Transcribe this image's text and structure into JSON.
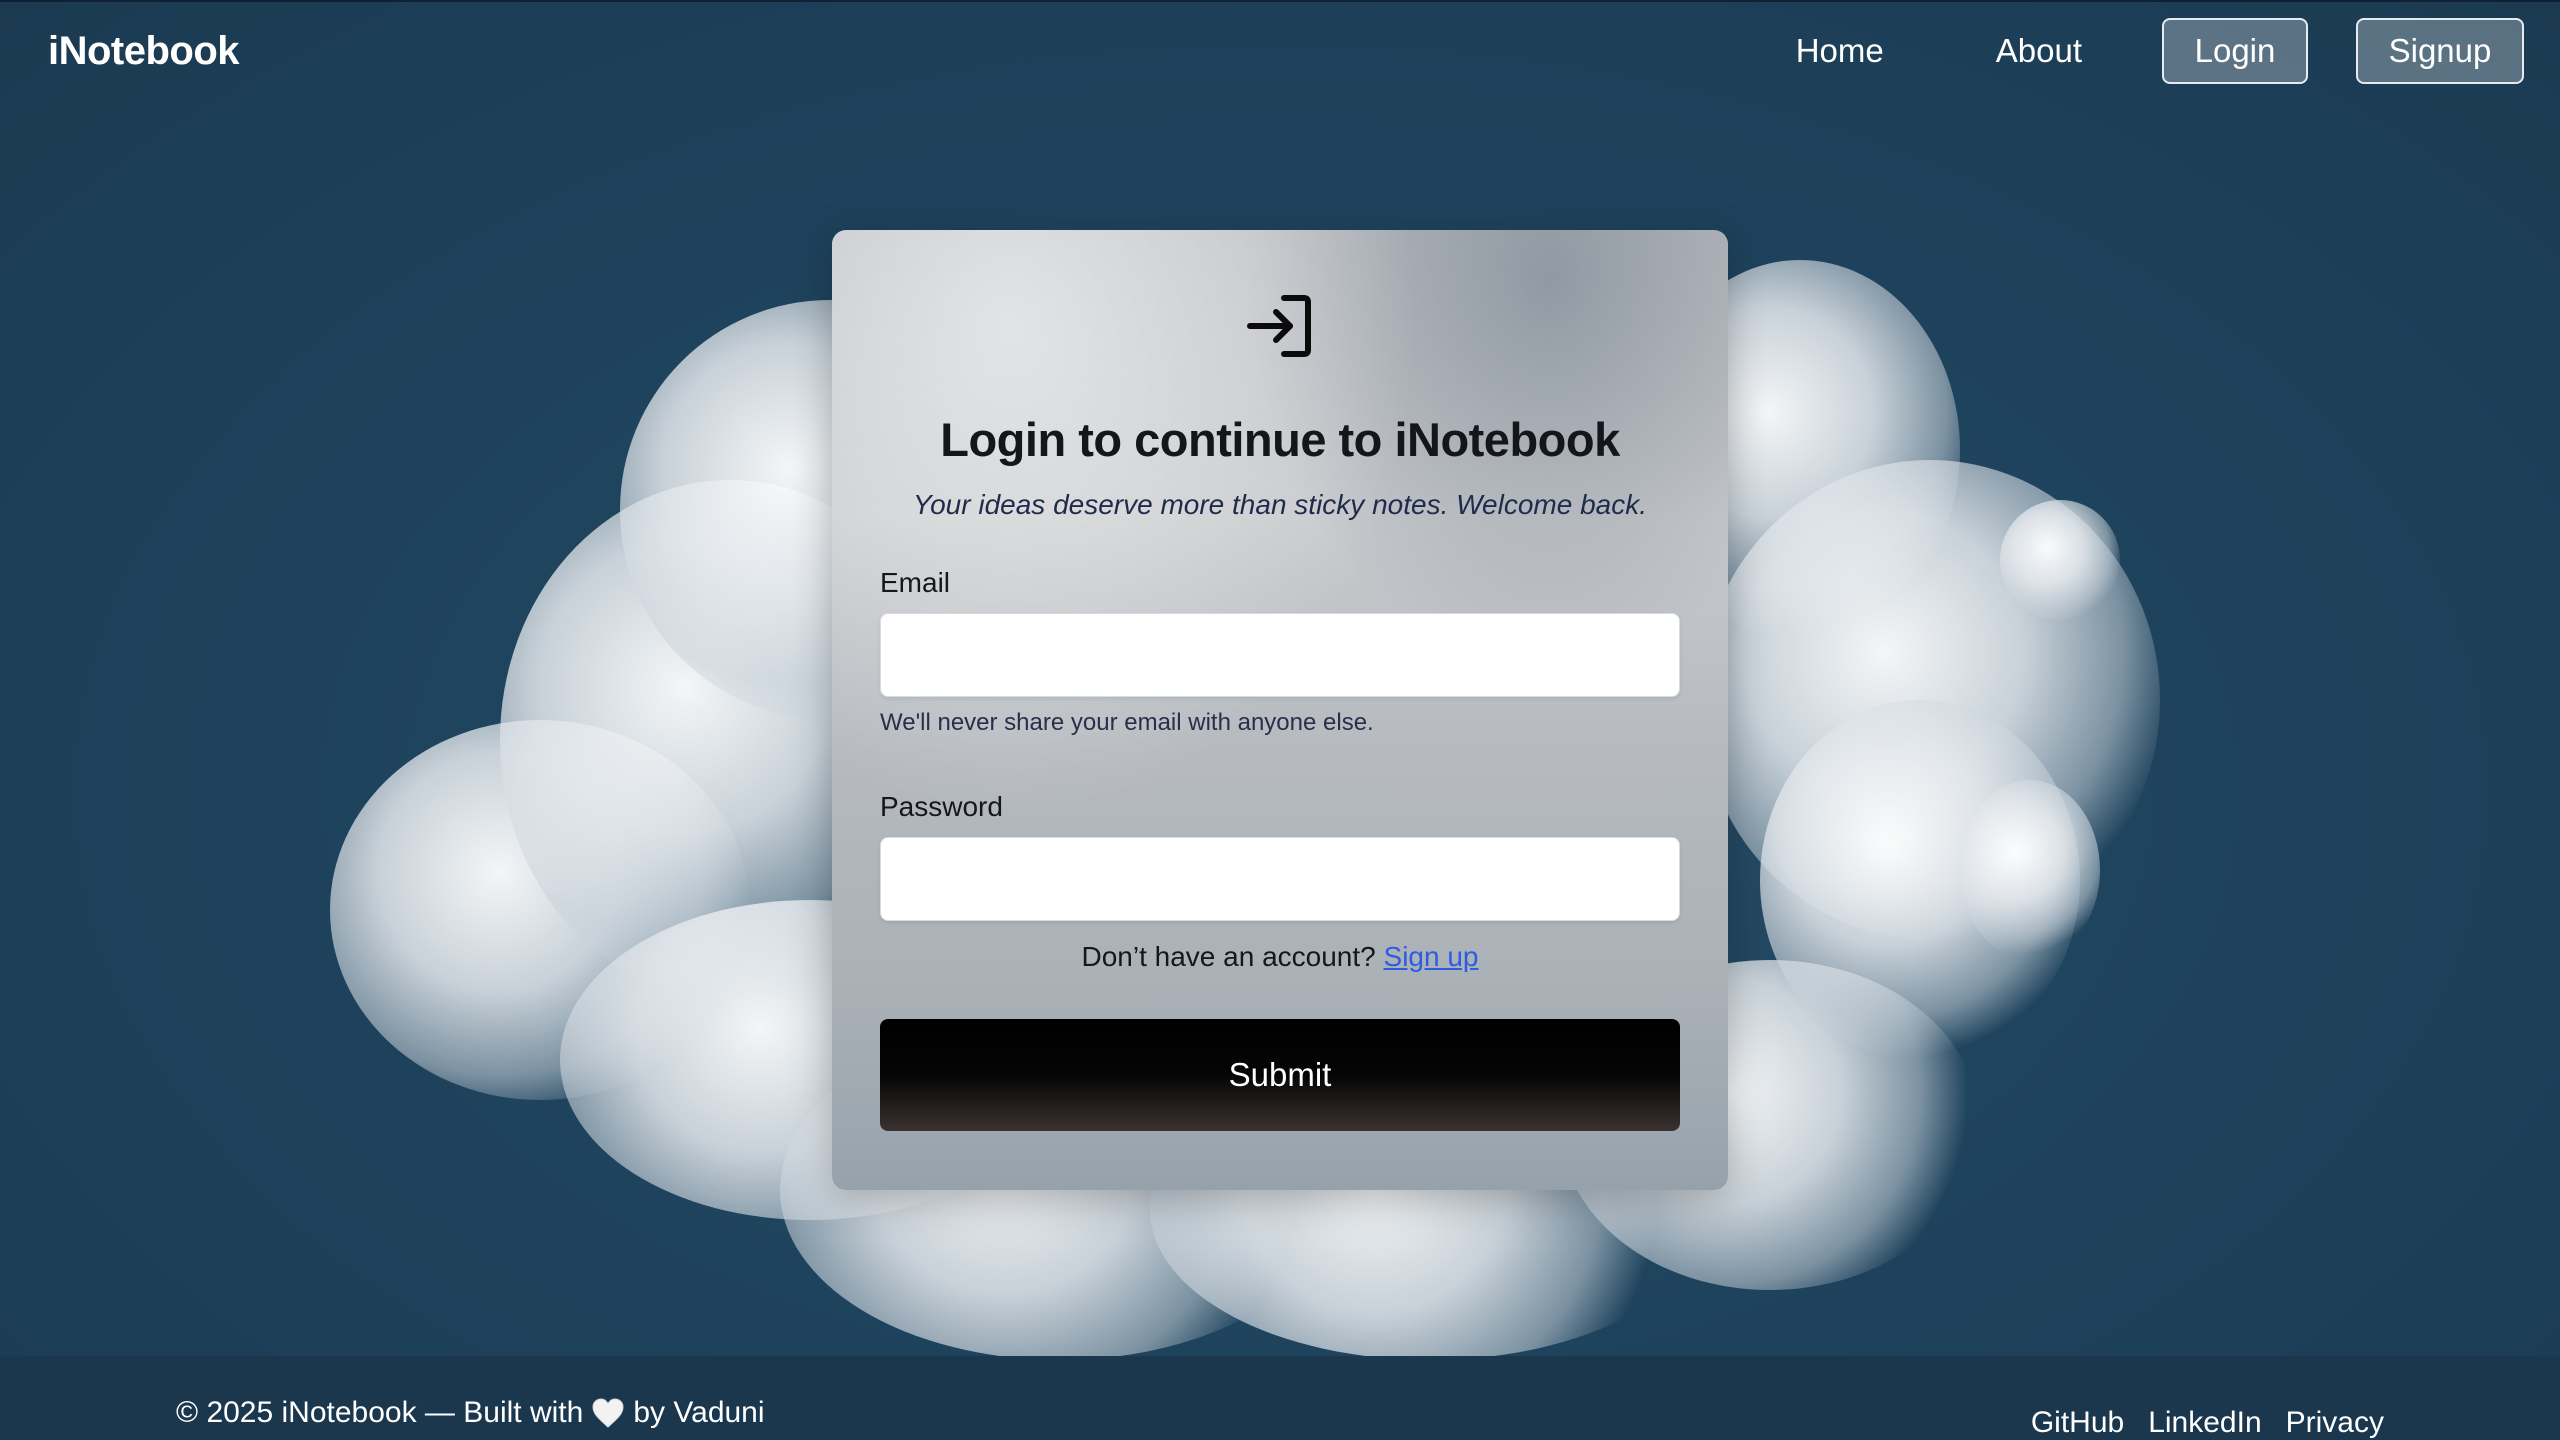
{
  "navbar": {
    "brand": "iNotebook",
    "links": {
      "home": "Home",
      "about": "About"
    },
    "buttons": {
      "login": "Login",
      "signup": "Signup"
    }
  },
  "card": {
    "icon": "login-arrow-icon",
    "title": "Login to continue to iNotebook",
    "subtitle": "Your ideas deserve more than sticky notes. Welcome back.",
    "email": {
      "label": "Email",
      "value": "",
      "help": "We'll never share your email with anyone else."
    },
    "password": {
      "label": "Password",
      "value": ""
    },
    "alt_prompt": "Don’t have an account?",
    "alt_link": "Sign up",
    "submit_label": "Submit"
  },
  "footer": {
    "copyright_before": "© 2025 iNotebook — Built with",
    "heart_icon": "white-heart-icon",
    "copyright_after": "by Vaduni",
    "links": [
      "GitHub",
      "LinkedIn",
      "Privacy"
    ]
  },
  "colors": {
    "background": "#1f445e",
    "footer_bg": "#1a374d",
    "link": "#2e5ce0",
    "submit_bg": "#000000"
  }
}
